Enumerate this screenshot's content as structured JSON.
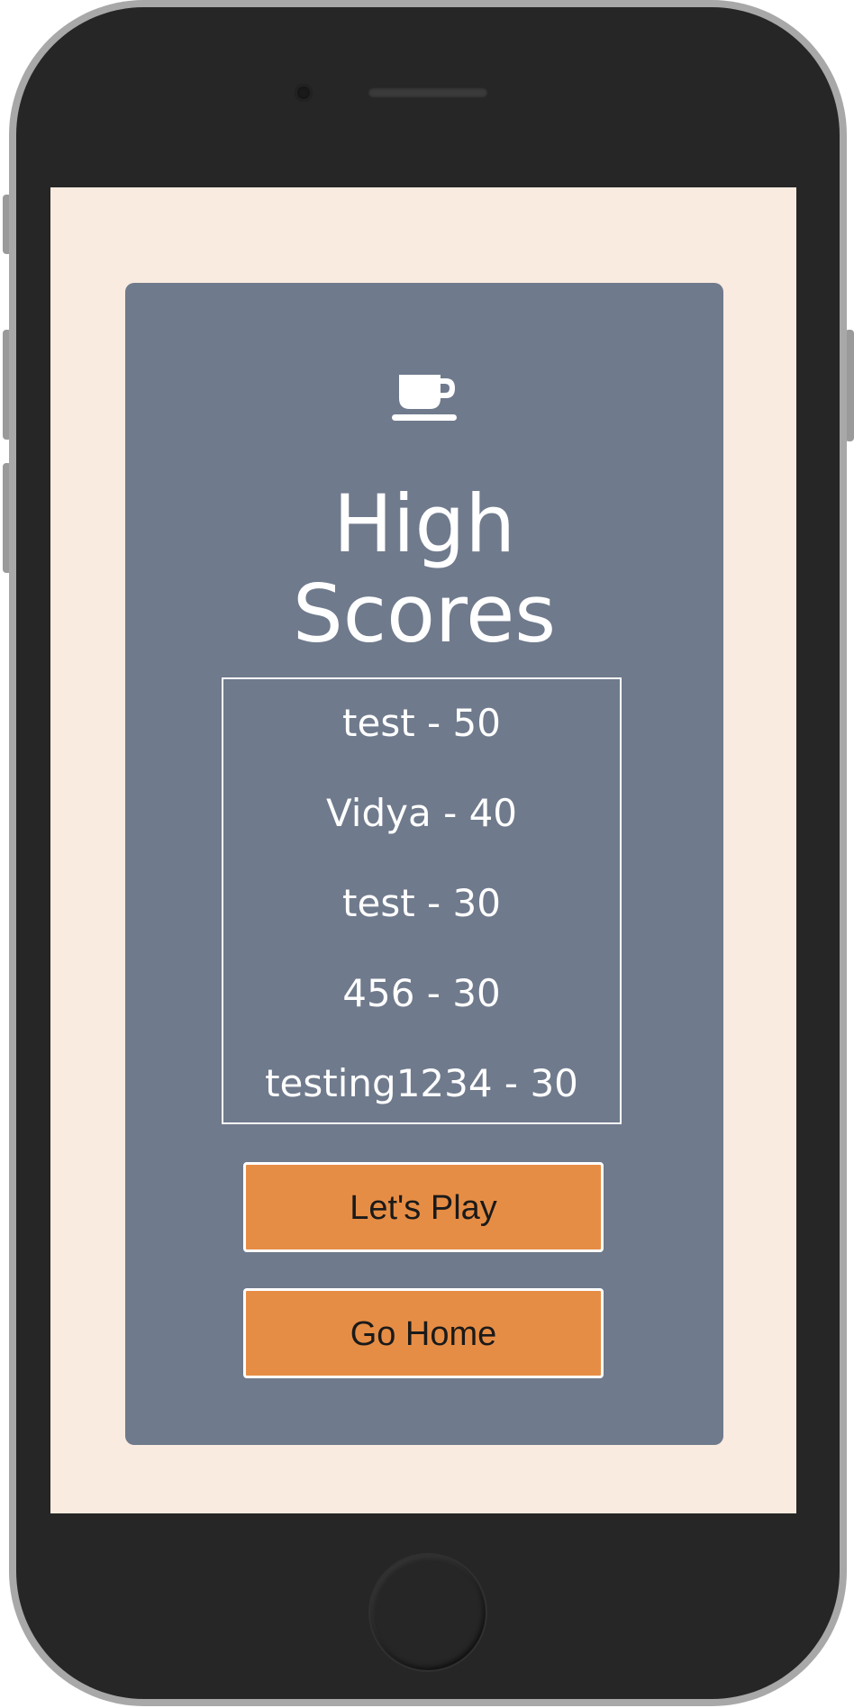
{
  "card": {
    "icon": "coffee-cup-icon",
    "title_line1": "High",
    "title_line2": "Scores"
  },
  "scores": [
    "test - 50",
    "Vidya - 40",
    "test - 30",
    "456 - 30",
    "testing1234 - 30"
  ],
  "buttons": {
    "play_label": "Let's Play",
    "home_label": "Go Home"
  },
  "colors": {
    "screen_bg": "#f9ebdf",
    "card_bg": "#6f7a8c",
    "button_bg": "#e68d45",
    "text_light": "#ffffff",
    "phone_body": "#262626"
  }
}
